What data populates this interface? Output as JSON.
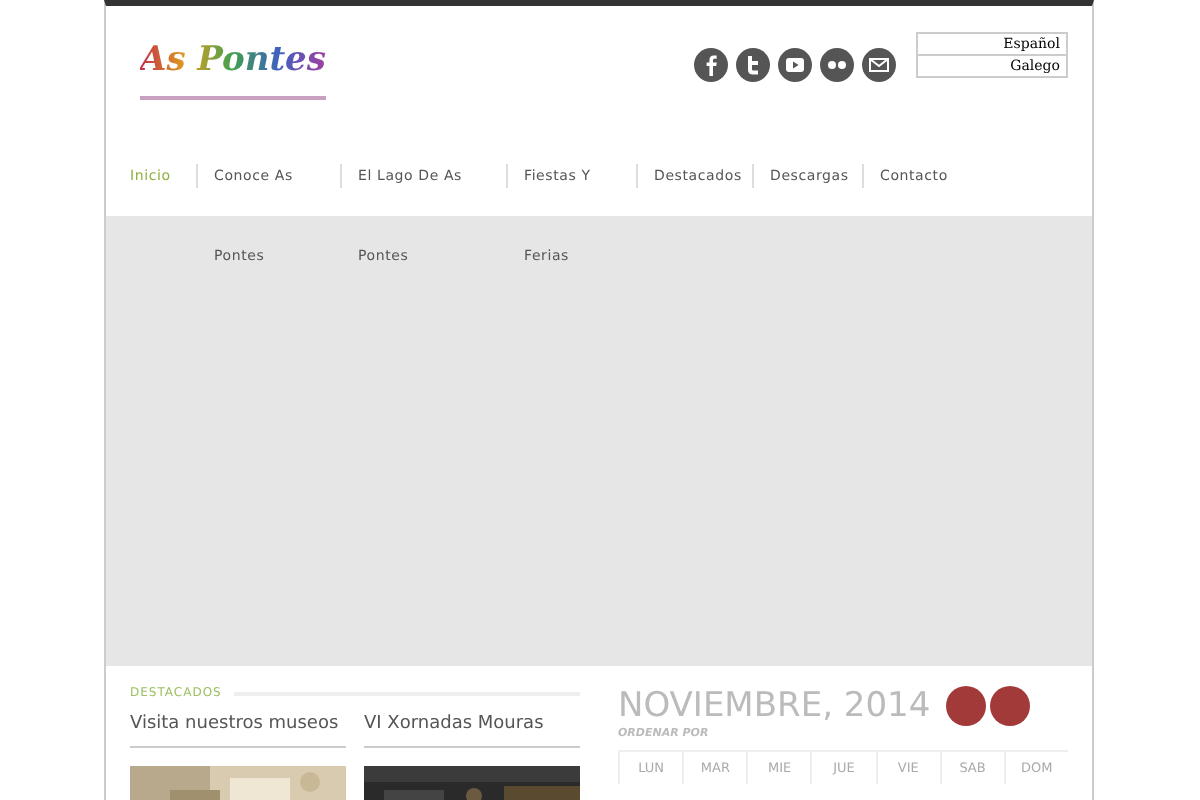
{
  "header": {
    "logo": "As Pontes",
    "languages": [
      "Español",
      "Galego"
    ]
  },
  "nav": [
    {
      "label": "Inicio",
      "selected": true
    },
    {
      "label": "Conoce As Pontes",
      "selected": false
    },
    {
      "label": "El Lago De As Pontes",
      "selected": false
    },
    {
      "label": "Fiestas Y Ferias",
      "selected": false
    },
    {
      "label": "Destacados",
      "selected": false
    },
    {
      "label": "Descargas",
      "selected": false
    },
    {
      "label": "Contacto",
      "selected": false
    }
  ],
  "featured": {
    "heading": "DESTACADOS",
    "cards": [
      {
        "title": "Visita nuestros museos",
        "kind": "picture"
      },
      {
        "title": "VI Xornadas Mouras",
        "kind": "picture"
      }
    ]
  },
  "calendar": {
    "month": "NOVIEMBRE, 2014",
    "sort_label": "ORDENAR POR",
    "days": [
      "LUN",
      "MAR",
      "MIE",
      "JUE",
      "VIE",
      "SAB",
      "DOM"
    ]
  }
}
